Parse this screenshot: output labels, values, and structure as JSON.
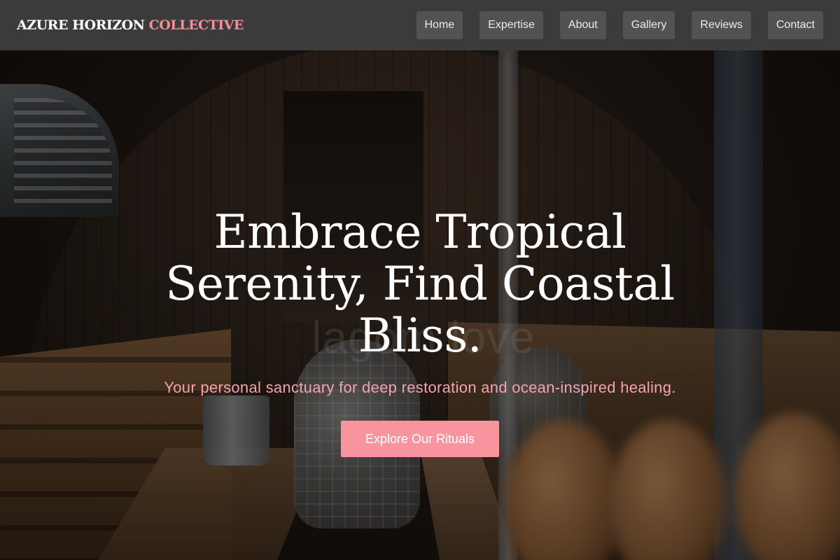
{
  "brand": {
    "name_main": "AZURE HORIZON",
    "name_accent": "COLLECTIVE"
  },
  "nav": {
    "items": [
      {
        "label": "Home"
      },
      {
        "label": "Expertise"
      },
      {
        "label": "About"
      },
      {
        "label": "Gallery"
      },
      {
        "label": "Reviews"
      },
      {
        "label": "Contact"
      }
    ]
  },
  "hero": {
    "title": "Embrace Tropical Serenity, Find Coastal Bliss.",
    "subtitle": "Your personal sanctuary for deep restoration and ocean-inspired healing.",
    "cta_label": "Explore Our Rituals",
    "background_sign_text": "lagom love"
  },
  "colors": {
    "navbar_bg": "#3b3b3b",
    "nav_button_bg": "#525252",
    "accent": "#f08f9a",
    "cta_bg": "#f7949e",
    "subtitle_color": "#f4a3ac"
  }
}
